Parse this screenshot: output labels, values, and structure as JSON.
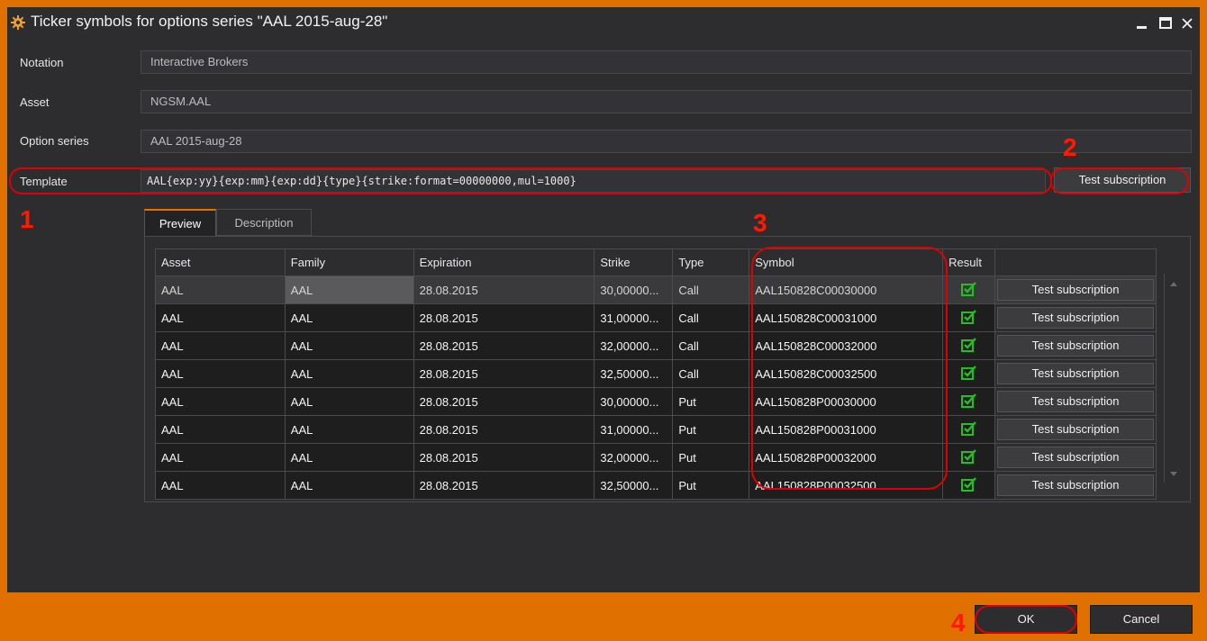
{
  "window": {
    "title": "Ticker symbols for options series \"AAL 2015-aug-28\"",
    "icon": "gear-icon",
    "controls": [
      "minimize-icon",
      "maximize-icon",
      "close-icon"
    ]
  },
  "form": {
    "notation_label": "Notation",
    "notation_value": "Interactive Brokers",
    "asset_label": "Asset",
    "asset_value": "NGSM.AAL",
    "option_series_label": "Option series",
    "option_series_value": "AAL 2015-aug-28",
    "template_label": "Template",
    "template_value": "AAL{exp:yy}{exp:mm}{exp:dd}{type}{strike:format=00000000,mul=1000}",
    "test_button": "Test subscription"
  },
  "annotations": [
    "1",
    "2",
    "3",
    "4"
  ],
  "tabs": [
    {
      "label": "Preview",
      "active": true
    },
    {
      "label": "Description",
      "active": false
    }
  ],
  "grid": {
    "columns": [
      "Asset",
      "Family",
      "Expiration",
      "Strike",
      "Type",
      "Symbol",
      "Result",
      ""
    ],
    "rows": [
      {
        "asset": "AAL",
        "family": "AAL",
        "expiration": "28.08.2015",
        "strike": "30,00000...",
        "type": "Call",
        "symbol": "AAL150828C00030000",
        "result": "check-icon",
        "button": "Test subscription"
      },
      {
        "asset": "AAL",
        "family": "AAL",
        "expiration": "28.08.2015",
        "strike": "31,00000...",
        "type": "Call",
        "symbol": "AAL150828C00031000",
        "result": "check-icon",
        "button": "Test subscription"
      },
      {
        "asset": "AAL",
        "family": "AAL",
        "expiration": "28.08.2015",
        "strike": "32,00000...",
        "type": "Call",
        "symbol": "AAL150828C00032000",
        "result": "check-icon",
        "button": "Test subscription"
      },
      {
        "asset": "AAL",
        "family": "AAL",
        "expiration": "28.08.2015",
        "strike": "32,50000...",
        "type": "Call",
        "symbol": "AAL150828C00032500",
        "result": "check-icon",
        "button": "Test subscription"
      },
      {
        "asset": "AAL",
        "family": "AAL",
        "expiration": "28.08.2015",
        "strike": "30,00000...",
        "type": "Put",
        "symbol": "AAL150828P00030000",
        "result": "check-icon",
        "button": "Test subscription"
      },
      {
        "asset": "AAL",
        "family": "AAL",
        "expiration": "28.08.2015",
        "strike": "31,00000...",
        "type": "Put",
        "symbol": "AAL150828P00031000",
        "result": "check-icon",
        "button": "Test subscription"
      },
      {
        "asset": "AAL",
        "family": "AAL",
        "expiration": "28.08.2015",
        "strike": "32,00000...",
        "type": "Put",
        "symbol": "AAL150828P00032000",
        "result": "check-icon",
        "button": "Test subscription"
      },
      {
        "asset": "AAL",
        "family": "AAL",
        "expiration": "28.08.2015",
        "strike": "32,50000...",
        "type": "Put",
        "symbol": "AAL150828P00032500",
        "result": "check-icon",
        "button": "Test subscription"
      }
    ]
  },
  "footer": {
    "ok": "OK",
    "cancel": "Cancel"
  },
  "colors": {
    "accent": "#e07000",
    "background": "#2d2d30",
    "annotation": "#e00000",
    "check": "#22c020"
  }
}
